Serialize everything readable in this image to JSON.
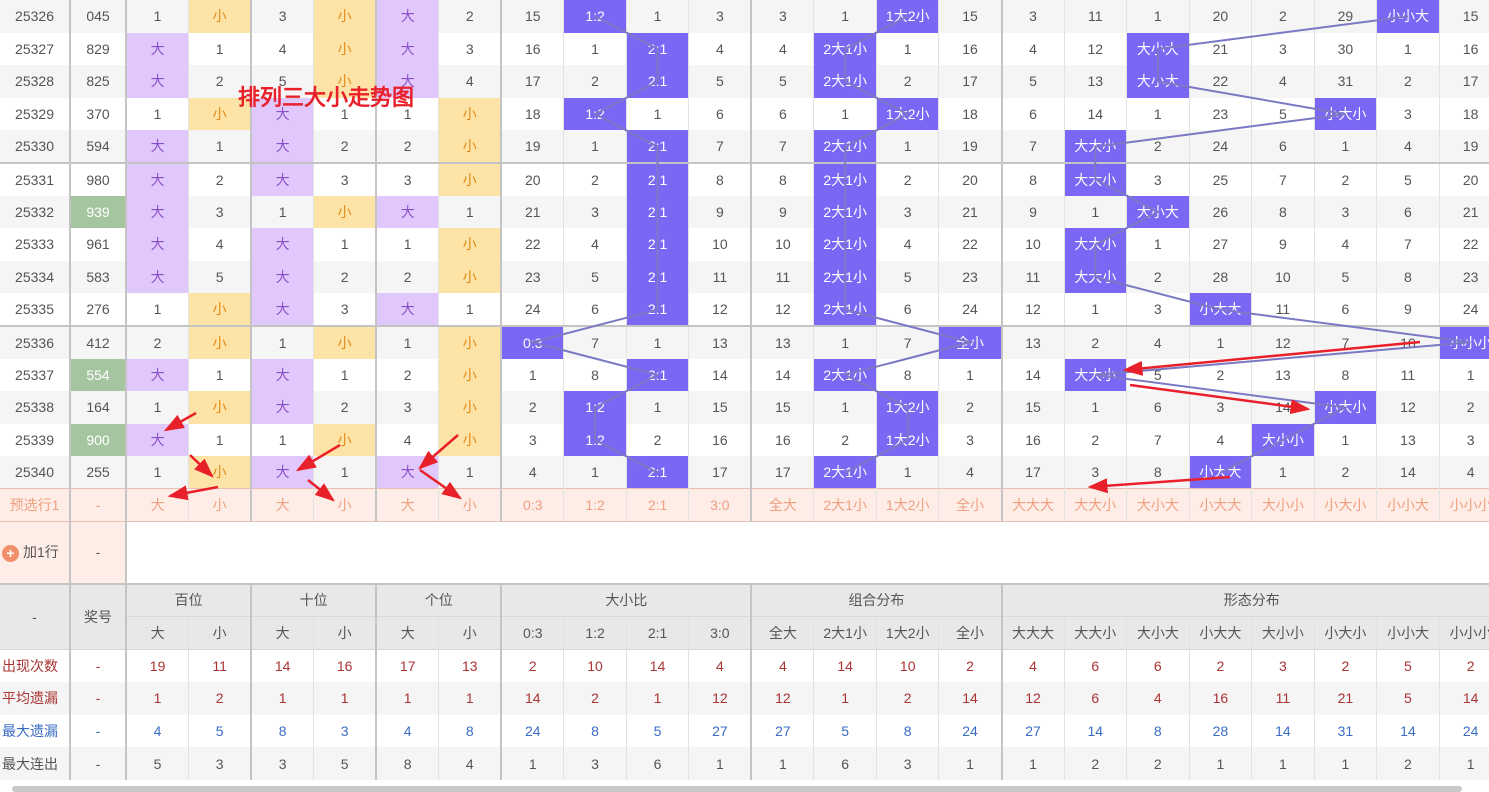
{
  "title": "排列三大小走势图",
  "rows": [
    {
      "period": "25326",
      "num": "045",
      "cells": [
        "1",
        "小",
        "3",
        "小",
        "大",
        "2",
        "15",
        "1:2",
        "1",
        "3",
        "3",
        "1",
        "1大2小",
        "15",
        "3",
        "11",
        "1",
        "20",
        "2",
        "29",
        "小小大",
        "15"
      ]
    },
    {
      "period": "25327",
      "num": "829",
      "cells": [
        "大",
        "1",
        "4",
        "小",
        "大",
        "3",
        "16",
        "1",
        "2:1",
        "4",
        "4",
        "2大1小",
        "1",
        "16",
        "4",
        "12",
        "大小大",
        "21",
        "3",
        "30",
        "1",
        "16"
      ]
    },
    {
      "period": "25328",
      "num": "825",
      "cells": [
        "大",
        "2",
        "5",
        "小",
        "大",
        "4",
        "17",
        "2",
        "2:1",
        "5",
        "5",
        "2大1小",
        "2",
        "17",
        "5",
        "13",
        "大小大",
        "22",
        "4",
        "31",
        "2",
        "17"
      ]
    },
    {
      "period": "25329",
      "num": "370",
      "cells": [
        "1",
        "小",
        "大",
        "1",
        "1",
        "小",
        "18",
        "1:2",
        "1",
        "6",
        "6",
        "1",
        "1大2小",
        "18",
        "6",
        "14",
        "1",
        "23",
        "5",
        "小大小",
        "3",
        "18"
      ]
    },
    {
      "period": "25330",
      "num": "594",
      "cells": [
        "大",
        "1",
        "大",
        "2",
        "2",
        "小",
        "19",
        "1",
        "2:1",
        "7",
        "7",
        "2大1小",
        "1",
        "19",
        "7",
        "大大小",
        "2",
        "24",
        "6",
        "1",
        "4",
        "19"
      ]
    },
    {
      "period": "25331",
      "num": "980",
      "cells": [
        "大",
        "2",
        "大",
        "3",
        "3",
        "小",
        "20",
        "2",
        "2:1",
        "8",
        "8",
        "2大1小",
        "2",
        "20",
        "8",
        "大大小",
        "3",
        "25",
        "7",
        "2",
        "5",
        "20"
      ]
    },
    {
      "period": "25332",
      "num": "939",
      "green": true,
      "cells": [
        "大",
        "3",
        "1",
        "小",
        "大",
        "1",
        "21",
        "3",
        "2:1",
        "9",
        "9",
        "2大1小",
        "3",
        "21",
        "9",
        "1",
        "大小大",
        "26",
        "8",
        "3",
        "6",
        "21"
      ]
    },
    {
      "period": "25333",
      "num": "961",
      "cells": [
        "大",
        "4",
        "大",
        "1",
        "1",
        "小",
        "22",
        "4",
        "2:1",
        "10",
        "10",
        "2大1小",
        "4",
        "22",
        "10",
        "大大小",
        "1",
        "27",
        "9",
        "4",
        "7",
        "22"
      ]
    },
    {
      "period": "25334",
      "num": "583",
      "cells": [
        "大",
        "5",
        "大",
        "2",
        "2",
        "小",
        "23",
        "5",
        "2:1",
        "11",
        "11",
        "2大1小",
        "5",
        "23",
        "11",
        "大大小",
        "2",
        "28",
        "10",
        "5",
        "8",
        "23"
      ]
    },
    {
      "period": "25335",
      "num": "276",
      "cells": [
        "1",
        "小",
        "大",
        "3",
        "大",
        "1",
        "24",
        "6",
        "2:1",
        "12",
        "12",
        "2大1小",
        "6",
        "24",
        "12",
        "1",
        "3",
        "小大大",
        "11",
        "6",
        "9",
        "24"
      ]
    },
    {
      "period": "25336",
      "num": "412",
      "cells": [
        "2",
        "小",
        "1",
        "小",
        "1",
        "小",
        "0:3",
        "7",
        "1",
        "13",
        "13",
        "1",
        "7",
        "全小",
        "13",
        "2",
        "4",
        "1",
        "12",
        "7",
        "10",
        "小小小"
      ]
    },
    {
      "period": "25337",
      "num": "554",
      "green": true,
      "cells": [
        "大",
        "1",
        "大",
        "1",
        "2",
        "小",
        "1",
        "8",
        "2:1",
        "14",
        "14",
        "2大1小",
        "8",
        "1",
        "14",
        "大大小",
        "5",
        "2",
        "13",
        "8",
        "11",
        "1"
      ]
    },
    {
      "period": "25338",
      "num": "164",
      "cells": [
        "1",
        "小",
        "大",
        "2",
        "3",
        "小",
        "2",
        "1:2",
        "1",
        "15",
        "15",
        "1",
        "1大2小",
        "2",
        "15",
        "1",
        "6",
        "3",
        "14",
        "小大小",
        "12",
        "2"
      ]
    },
    {
      "period": "25339",
      "num": "900",
      "green": true,
      "cells": [
        "大",
        "1",
        "1",
        "小",
        "4",
        "小",
        "3",
        "1:2",
        "2",
        "16",
        "16",
        "2",
        "1大2小",
        "3",
        "16",
        "2",
        "7",
        "4",
        "大小小",
        "1",
        "13",
        "3"
      ]
    },
    {
      "period": "25340",
      "num": "255",
      "cells": [
        "1",
        "小",
        "大",
        "1",
        "大",
        "1",
        "4",
        "1",
        "2:1",
        "17",
        "17",
        "2大1小",
        "1",
        "4",
        "17",
        "3",
        "8",
        "小大大",
        "1",
        "2",
        "14",
        "4"
      ]
    }
  ],
  "preselect": {
    "label": "预选行1",
    "num": "-",
    "cells": [
      "大",
      "小",
      "大",
      "小",
      "大",
      "小",
      "0:3",
      "1:2",
      "2:1",
      "3:0",
      "全大",
      "2大1小",
      "1大2小",
      "全小",
      "大大大",
      "大大小",
      "大小大",
      "小大大",
      "大小小",
      "小大小",
      "小小大",
      "小小小"
    ]
  },
  "add_row": {
    "label": "加1行",
    "icon": "+",
    "num": "-"
  },
  "header": {
    "corner": "-",
    "num": "奖号",
    "groups": [
      "百位",
      "十位",
      "个位",
      "大小比",
      "组合分布",
      "形态分布"
    ],
    "sub": [
      "大",
      "小",
      "大",
      "小",
      "大",
      "小",
      "0:3",
      "1:2",
      "2:1",
      "3:0",
      "全大",
      "2大1小",
      "1大2小",
      "全小",
      "大大大",
      "大大小",
      "大小大",
      "小大大",
      "大小小",
      "小大小",
      "小小大",
      "小小小"
    ]
  },
  "stats": [
    {
      "label": "出现次数",
      "num": "-",
      "values": [
        "19",
        "11",
        "14",
        "16",
        "17",
        "13",
        "2",
        "10",
        "14",
        "4",
        "4",
        "14",
        "10",
        "2",
        "4",
        "6",
        "6",
        "2",
        "3",
        "2",
        "5",
        "2"
      ]
    },
    {
      "label": "平均遗漏",
      "num": "-",
      "values": [
        "1",
        "2",
        "1",
        "1",
        "1",
        "1",
        "14",
        "2",
        "1",
        "12",
        "12",
        "1",
        "2",
        "14",
        "12",
        "6",
        "4",
        "16",
        "11",
        "21",
        "5",
        "14"
      ]
    },
    {
      "label": "最大遗漏",
      "num": "-",
      "values": [
        "4",
        "5",
        "8",
        "3",
        "4",
        "8",
        "24",
        "8",
        "5",
        "27",
        "27",
        "5",
        "8",
        "24",
        "27",
        "14",
        "8",
        "28",
        "14",
        "31",
        "14",
        "24"
      ]
    },
    {
      "label": "最大连出",
      "num": "-",
      "values": [
        "5",
        "3",
        "3",
        "5",
        "8",
        "4",
        "1",
        "3",
        "6",
        "1",
        "1",
        "6",
        "3",
        "1",
        "1",
        "2",
        "2",
        "1",
        "1",
        "1",
        "2",
        "1"
      ]
    }
  ],
  "colors": {
    "hit": "#7a68f5",
    "big": "#e1c8fc",
    "small": "#fde4a6",
    "line": "#7b78c4",
    "annotation": "#e8202a"
  }
}
